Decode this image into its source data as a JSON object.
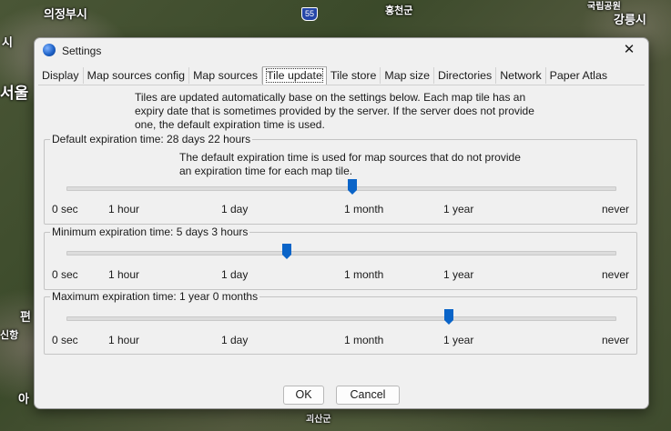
{
  "map": {
    "labels": [
      "의정부시",
      "홍천군",
      "강릉시",
      "시",
      "서울",
      "편",
      "신항",
      "아",
      "괴산군",
      "국립공원"
    ],
    "shield": "55"
  },
  "window": {
    "title": "Settings",
    "close_glyph": "✕"
  },
  "tabs": [
    {
      "label": "Display"
    },
    {
      "label": "Map sources config"
    },
    {
      "label": "Map sources"
    },
    {
      "label": "Tile update"
    },
    {
      "label": "Tile store"
    },
    {
      "label": "Map size"
    },
    {
      "label": "Directories"
    },
    {
      "label": "Network"
    },
    {
      "label": "Paper Atlas"
    }
  ],
  "active_tab": "Tile update",
  "intro": "Tiles are updated automatically base on the settings below. Each map tile has an expiry date that is sometimes provided by the server. If the server does not provide one, the default expiration time is used.",
  "slider_ticks": [
    "0 sec",
    "1 hour",
    "1 day",
    "1 month",
    "1 year",
    "never"
  ],
  "groups": {
    "default": {
      "title": "Default expiration time: 28 days 22 hours",
      "description": "The default expiration time is used for map sources that do not provide an expiration time for each map tile.",
      "value_fraction": 0.52
    },
    "minimum": {
      "title": "Minimum expiration time: 5 days 3 hours",
      "value_fraction": 0.4
    },
    "maximum": {
      "title": "Maximum expiration time: 1 year 0 months",
      "value_fraction": 0.695
    }
  },
  "buttons": {
    "ok": "OK",
    "cancel": "Cancel"
  },
  "colors": {
    "accent": "#0a64c8"
  }
}
